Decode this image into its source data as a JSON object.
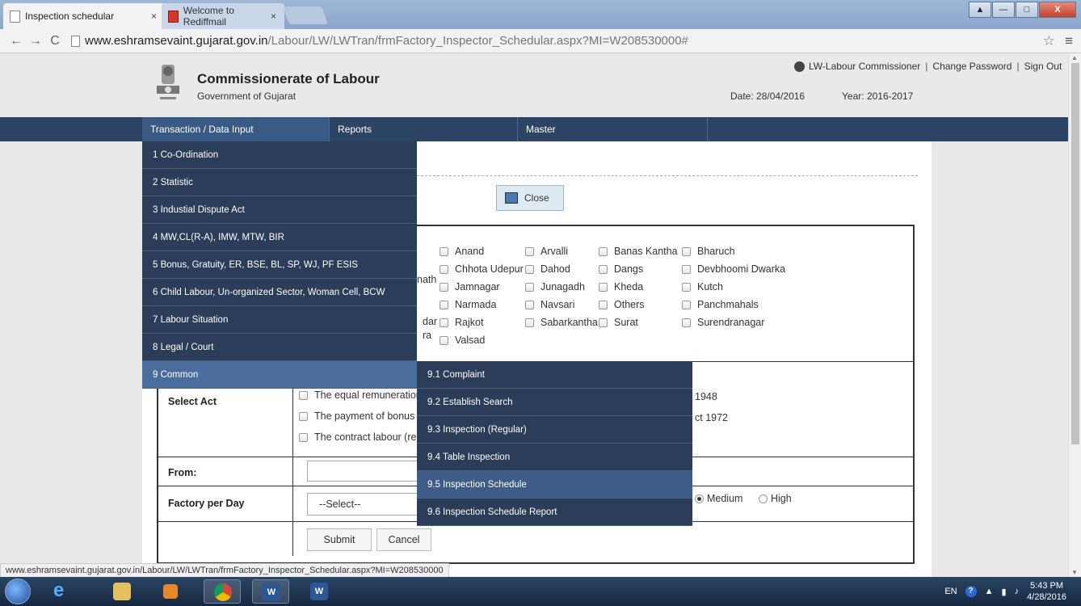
{
  "browser": {
    "tabs": [
      {
        "title": "Inspection schedular",
        "close": "×"
      },
      {
        "title": "Welcome to Rediffmail",
        "close": "×"
      }
    ],
    "url_domain": "www.eshramsevaint.gujarat.gov.in",
    "url_path": "/Labour/LW/LWTran/frmFactory_Inspector_Schedular.aspx?MI=W208530000#",
    "status_url": "www.eshramsevaint.gujarat.gov.in/Labour/LW/LWTran/frmFactory_Inspector_Schedular.aspx?MI=W208530000",
    "back": "←",
    "forward": "→",
    "reload": "C",
    "star": "☆",
    "menu": "≡"
  },
  "header": {
    "title": "Commissionerate of Labour",
    "subtitle": "Government of Gujarat",
    "user": "LW-Labour Commissioner",
    "change_password": "Change Password",
    "sign_out": "Sign Out",
    "sep": "|",
    "date_label": "Date:",
    "date_value": "28/04/2016",
    "year_label": "Year:",
    "year_value": "2016-2017"
  },
  "nav": {
    "items": [
      "Transaction / Data Input",
      "Reports",
      "Master"
    ]
  },
  "menu": {
    "items": [
      "1 Co-Ordination",
      "2 Statistic",
      "3 Industial Dispute Act",
      "4 MW,CL(R-A), IMW, MTW, BIR",
      "5 Bonus, Gratuity, ER, BSE, BL, SP, WJ, PF ESIS",
      "6 Child Labour, Un-organized Sector, Woman Cell, BCW",
      "7 Labour Situation",
      "8 Legal / Court",
      "9 Common"
    ],
    "submenu": [
      "9.1 Complaint",
      "9.2 Establish Search",
      "9.3 Inspection (Regular)",
      "9.4 Table Inspection",
      "9.5 Inspection Schedule",
      "9.6 Inspection Schedule Report"
    ]
  },
  "page": {
    "close_label": "Close",
    "districts_col1_partial": [
      "nath",
      "dar",
      "ra"
    ],
    "districts": [
      "Anand",
      "Arvalli",
      "Banas Kantha",
      "Bharuch",
      "Chhota Udepur",
      "Dahod",
      "Dangs",
      "Devbhoomi Dwarka",
      "Jamnagar",
      "Junagadh",
      "Kheda",
      "Kutch",
      "Narmada",
      "Navsari",
      "Others",
      "Panchmahals",
      "Rajkot",
      "Sabarkantha",
      "Surat",
      "Surendranagar",
      "Valsad"
    ],
    "select_act_label": "Select Act",
    "acts_visible": [
      "The equal remuneratior",
      "The payment of bonus",
      "The contract labour (re"
    ],
    "acts_right_partial": [
      "1948",
      "ct 1972"
    ],
    "from_label": "From:",
    "factory_per_day_label": "Factory per Day",
    "select_placeholder": "--Select--",
    "priority_options": [
      "Medium",
      "High"
    ],
    "submit_label": "Submit",
    "cancel_label": "Cancel"
  },
  "taskbar": {
    "lang": "EN",
    "time": "5:43 PM",
    "date": "4/28/2016"
  }
}
